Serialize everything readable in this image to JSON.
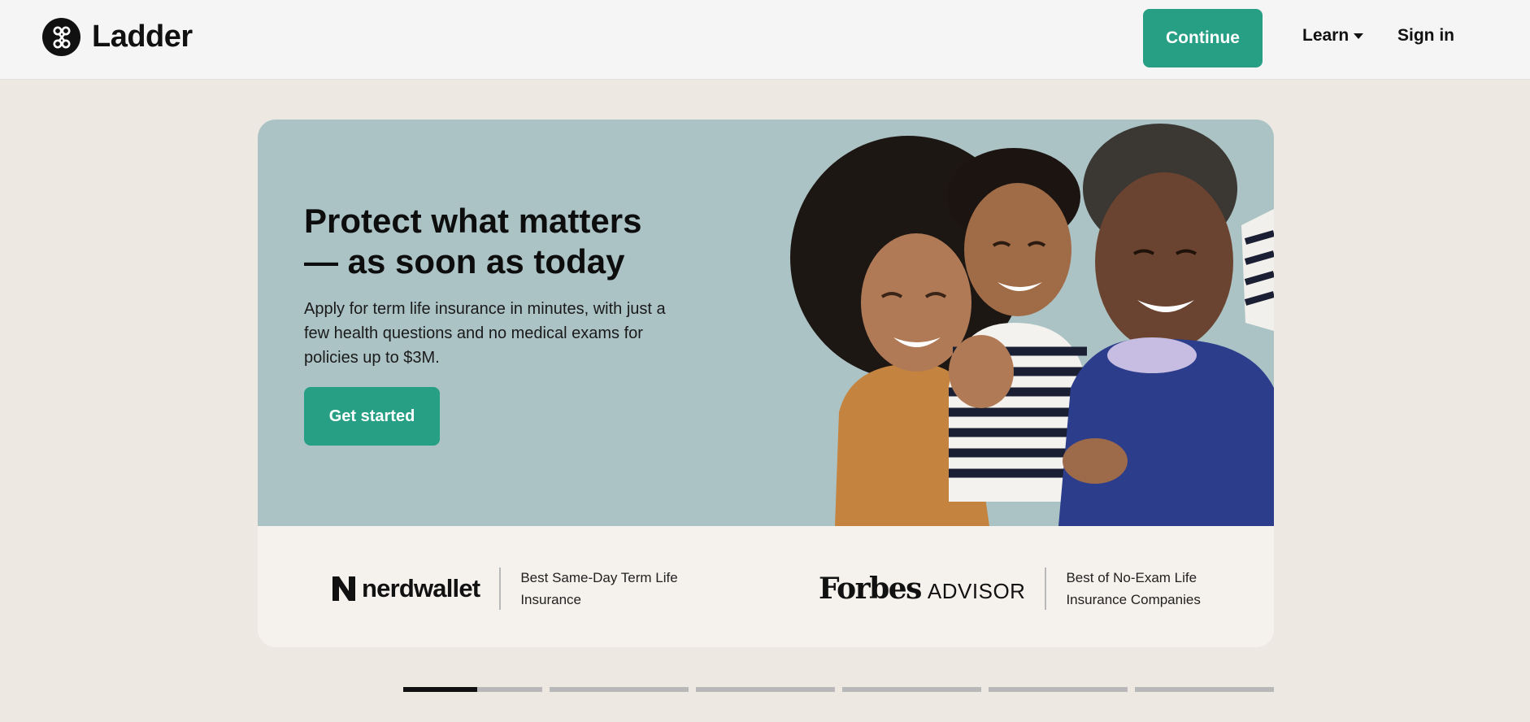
{
  "brand": {
    "name": "Ladder"
  },
  "nav": {
    "continue_label": "Continue",
    "learn_label": "Learn",
    "signin_label": "Sign in"
  },
  "hero": {
    "title_line1": "Protect what matters",
    "title_line2": "— as soon as today",
    "subtitle": "Apply for term life insurance in minutes, with just a few health questions and no medical exams for policies up to $3M.",
    "cta_label": "Get started"
  },
  "press": [
    {
      "logo": "nerdwallet",
      "caption": "Best Same-Day Term Life Insurance"
    },
    {
      "logo_word": "Forbes",
      "logo_suffix": "ADVISOR",
      "caption": "Best of No-Exam Life Insurance Companies"
    }
  ],
  "carousel": {
    "slides": 6,
    "active_index": 0,
    "active_progress": 0.53
  },
  "colors": {
    "accent": "#279f85",
    "hero_bg": "#acc3c6",
    "page_bg": "#ede9e2",
    "topbar_bg": "#f5f5f5"
  }
}
